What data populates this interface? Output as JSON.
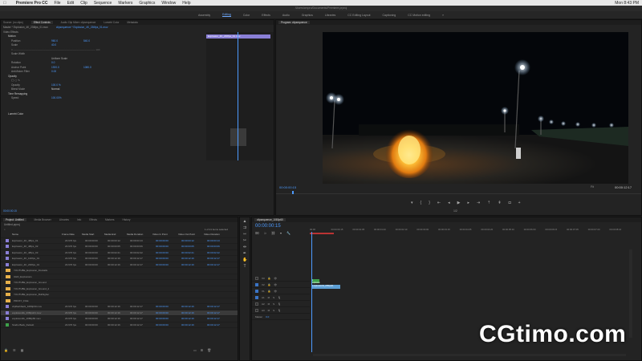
{
  "mac_menu": {
    "app_name": "Premiere Pro CC",
    "items": [
      "File",
      "Edit",
      "Clip",
      "Sequence",
      "Markers",
      "Graphics",
      "Window",
      "Help"
    ],
    "clock": "Mon 8:43 PM"
  },
  "window_title": "/Users/cmpro/Documents/Premiere.prproj",
  "workspaces": {
    "tabs": [
      "Assembly",
      "Editing",
      "Color",
      "Effects",
      "Audio",
      "Graphics",
      "Libraries",
      "CC Editing Layout",
      "Captioning",
      "CC Motion editing"
    ],
    "active_index": 1
  },
  "effect_controls": {
    "tabs": [
      "Source: (no clips)",
      "Effect Controls",
      "Audio Clip Mixer: clipsequence",
      "Lumetri Color",
      "Metadata"
    ],
    "active_index": 1,
    "source_label": "Master * Explosion_4K_236fps_01.mov",
    "sequence_label": "clipsequence * Explosion_4K_236fps_01.mov",
    "section_video": "Video Effects",
    "motion": "Motion",
    "rows": [
      {
        "label": "Position",
        "val1": "960.0",
        "val2": "540.0"
      },
      {
        "label": "Scale",
        "val1": "40.0",
        "val2": ""
      },
      {
        "label": "Scale Width",
        "val1": "",
        "val2": ""
      },
      {
        "label": "Uniform Scale",
        "val1": "",
        "val2": ""
      },
      {
        "label": "Rotation",
        "val1": "0.0",
        "val2": ""
      },
      {
        "label": "Anchor Point",
        "val1": "1920.0",
        "val2": "1080.0"
      },
      {
        "label": "Anti-flicker Filter",
        "val1": "0.00",
        "val2": ""
      }
    ],
    "opacity": "Opacity",
    "opacity_value": "100.0 %",
    "blend_mode_label": "Blend Mode",
    "blend_mode": "Normal",
    "time_remap": "Time Remapping",
    "speed_label": "Speed",
    "speed_value": "100.00%",
    "lumetri": "Lumetri Color",
    "timecode": "00:00:00:15",
    "clip_name": "Explosion_4K_236fps_01.mov"
  },
  "program_monitor": {
    "title": "Program: clipsequence",
    "timecode_left": "00:00:00:15",
    "fit": "Fit",
    "quality": "Full",
    "timecode_right": "00:00:12:17",
    "zoom": "1/2"
  },
  "project_panel": {
    "tabs": [
      "Project: Untitled",
      "Media Browser",
      "Libraries",
      "Info",
      "Effects",
      "Markers",
      "History"
    ],
    "active_index": 0,
    "path": "Untitled.prproj",
    "count": "1 of 21 items selected",
    "columns": [
      "Name",
      "Frame Rate",
      "Media Start",
      "Media End",
      "Media Duration",
      "Video In Point",
      "Video Out Point",
      "Video Duration"
    ],
    "rows": [
      {
        "kind": "clip",
        "name": "Explosion_4K_48fps_01",
        "fr": "23.976 fps",
        "ms": "00:00:00:00",
        "me": "00:00:03:12",
        "md": "00:00:03:13",
        "vi": "00:00:00:00",
        "vo": "00:00:03:12",
        "vd": "00:00:03:13"
      },
      {
        "kind": "clip",
        "name": "Explosion_4K_48fps_02",
        "fr": "23.976 fps",
        "ms": "00:00:00:00",
        "me": "00:00:03:05",
        "md": "00:00:03:06",
        "vi": "00:00:00:00",
        "vo": "00:00:03:05",
        "vd": "00:00:03:06"
      },
      {
        "kind": "clip",
        "name": "Explosion_4K_48fps_03",
        "fr": "23.976 fps",
        "ms": "00:00:00:00",
        "me": "00:00:02:21",
        "md": "00:00:02:22",
        "vi": "00:00:00:00",
        "vo": "00:00:02:21",
        "vd": "00:00:02:22"
      },
      {
        "kind": "clip",
        "name": "Explosion_4K_120fps_01",
        "fr": "23.976 fps",
        "ms": "00:00:00:00",
        "me": "00:00:12:16",
        "md": "00:00:12:17",
        "vi": "00:00:00:00",
        "vo": "00:00:12:16",
        "vd": "00:00:12:17"
      },
      {
        "kind": "clip",
        "name": "Explosion_4K_236fps_01",
        "fr": "23.976 fps",
        "ms": "00:00:00:00",
        "me": "00:00:12:16",
        "md": "00:00:12:17",
        "vi": "00:00:00:00",
        "vo": "00:00:12:16",
        "vd": "00:00:12:17"
      },
      {
        "kind": "bin",
        "name": "YOUTUBE_Explosion_Fireballs",
        "fr": "",
        "ms": "",
        "me": "",
        "md": "",
        "vi": "",
        "vo": "",
        "vd": ""
      },
      {
        "kind": "bin",
        "name": "UHD_Explosions",
        "fr": "",
        "ms": "",
        "me": "",
        "md": "",
        "vi": "",
        "vo": "",
        "vd": ""
      },
      {
        "kind": "bin",
        "name": "YOUTUBE_Explosion_Ground",
        "fr": "",
        "ms": "",
        "me": "",
        "md": "",
        "vi": "",
        "vo": "",
        "vd": ""
      },
      {
        "kind": "bin",
        "name": "YOUTUBE_Explosion_Ground_2",
        "fr": "",
        "ms": "",
        "me": "",
        "md": "",
        "vi": "",
        "vo": "",
        "vd": ""
      },
      {
        "kind": "bin",
        "name": "YOUTUBE_Explosion_Bullhigher",
        "fr": "",
        "ms": "",
        "me": "",
        "md": "",
        "vi": "",
        "vo": "",
        "vd": ""
      },
      {
        "kind": "bin",
        "name": "PROXY_FILE",
        "fr": "",
        "ms": "",
        "me": "",
        "md": "",
        "vi": "",
        "vo": "",
        "vd": ""
      },
      {
        "kind": "clip",
        "name": "clipflashback_1080p60.mov",
        "fr": "23.976 fps",
        "ms": "00:00:00:00",
        "me": "00:00:12:16",
        "md": "00:00:12:17",
        "vi": "00:00:00:00",
        "vo": "00:00:12:16",
        "vd": "00:00:12:17"
      },
      {
        "kind": "clip",
        "name": "explosion4k_236fps01.mov",
        "fr": "23.976 fps",
        "ms": "00:00:00:00",
        "me": "00:00:12:16",
        "md": "00:00:12:17",
        "vi": "00:00:00:00",
        "vo": "00:00:12:16",
        "vd": "00:00:12:17"
      },
      {
        "kind": "clip",
        "name": "explosion4k_1080p60.mov",
        "fr": "23.976 fps",
        "ms": "00:00:00:00",
        "me": "00:00:12:16",
        "md": "00:00:12:17",
        "vi": "00:00:00:00",
        "vo": "00:00:12:16",
        "vd": "00:00:12:17"
      },
      {
        "kind": "clip",
        "name": "Studio Back_Default",
        "fr": "23.976 fps",
        "ms": "00:00:00:00",
        "me": "00:00:12:16",
        "md": "00:00:12:17",
        "vi": "00:00:00:00",
        "vo": "00:00:12:16",
        "vd": "00:00:12:17"
      }
    ]
  },
  "timeline": {
    "title": "clipsequence_1080p60",
    "timecode": "00:00:00:15",
    "ruler": [
      "00:00",
      "00:00:00:15",
      "00:00:01:05",
      "00:00:01:20",
      "00:00:02:10",
      "00:00:03:00",
      "00:00:03:15",
      "00:00:04:05",
      "00:00:04:20",
      "00:00:05:10",
      "00:00:06:00",
      "00:00:06:15",
      "00:00:07:05",
      "00:00:07:20",
      "00:00:08:10"
    ],
    "tracks": [
      "V3",
      "V2",
      "V1",
      "A1",
      "A2",
      "A3"
    ],
    "master": "Master",
    "master_val": "0.0",
    "clip_v2": "fx Explosion",
    "clip_v1": "fx explosion4k_236fps01"
  },
  "watermark": "CGtimo.com",
  "colors": {
    "accent": "#4d9bff",
    "clip_purple": "#8a7fd6",
    "bin_orange": "#e6b04a",
    "clip_green": "#3da14a",
    "clip_blue": "#5d9fd4"
  }
}
